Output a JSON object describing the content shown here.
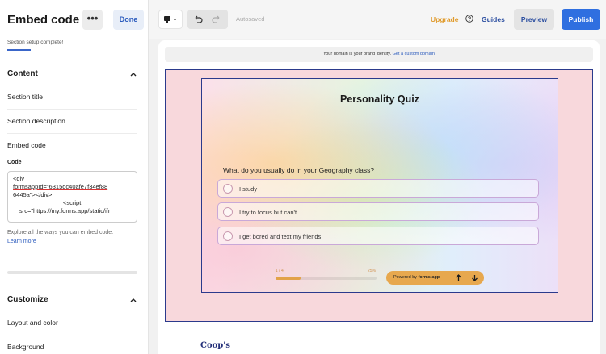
{
  "panel": {
    "title": "Embed code",
    "more_label": "•••",
    "done_label": "Done",
    "status": "Section setup complete!",
    "content_header": "Content",
    "rows": [
      "Section title",
      "Section description",
      "Embed code"
    ],
    "code_label": "Code",
    "code_lines": [
      "<div",
      "formsappId=\"6315dc40afe7f34ef88",
      "6445a\"></div>",
      "<script",
      "src=\"https://my.forms.app/static/ifr"
    ],
    "explore_text": "Explore all the ways you can embed code.",
    "learn_more": "Learn more",
    "customize_header": "Customize",
    "customize_rows": [
      "Layout and color",
      "Background"
    ]
  },
  "topbar": {
    "autosaved": "Autosaved",
    "upgrade": "Upgrade",
    "guides": "Guides",
    "preview": "Preview",
    "publish": "Publish"
  },
  "canvas": {
    "domain_text": "Your domain is your brand identity.",
    "domain_link": "Get a custom domain",
    "quiz_title": "Personality Quiz",
    "question": "What do you usually do in your Geography class?",
    "options": [
      "I study",
      "I try to focus but can't",
      "I get bored and text my friends"
    ],
    "progress_left": "1 / 4",
    "progress_right": "25%",
    "progress_value": 25,
    "powered_prefix": "Powered by ",
    "powered_brand": "forms.app",
    "footer_brand": "Coop's"
  },
  "colors": {
    "accent": "#2f6fe0",
    "upgrade": "#e09a2a",
    "pink_section": "#f8d8dc",
    "pill": "#e7a84e"
  }
}
